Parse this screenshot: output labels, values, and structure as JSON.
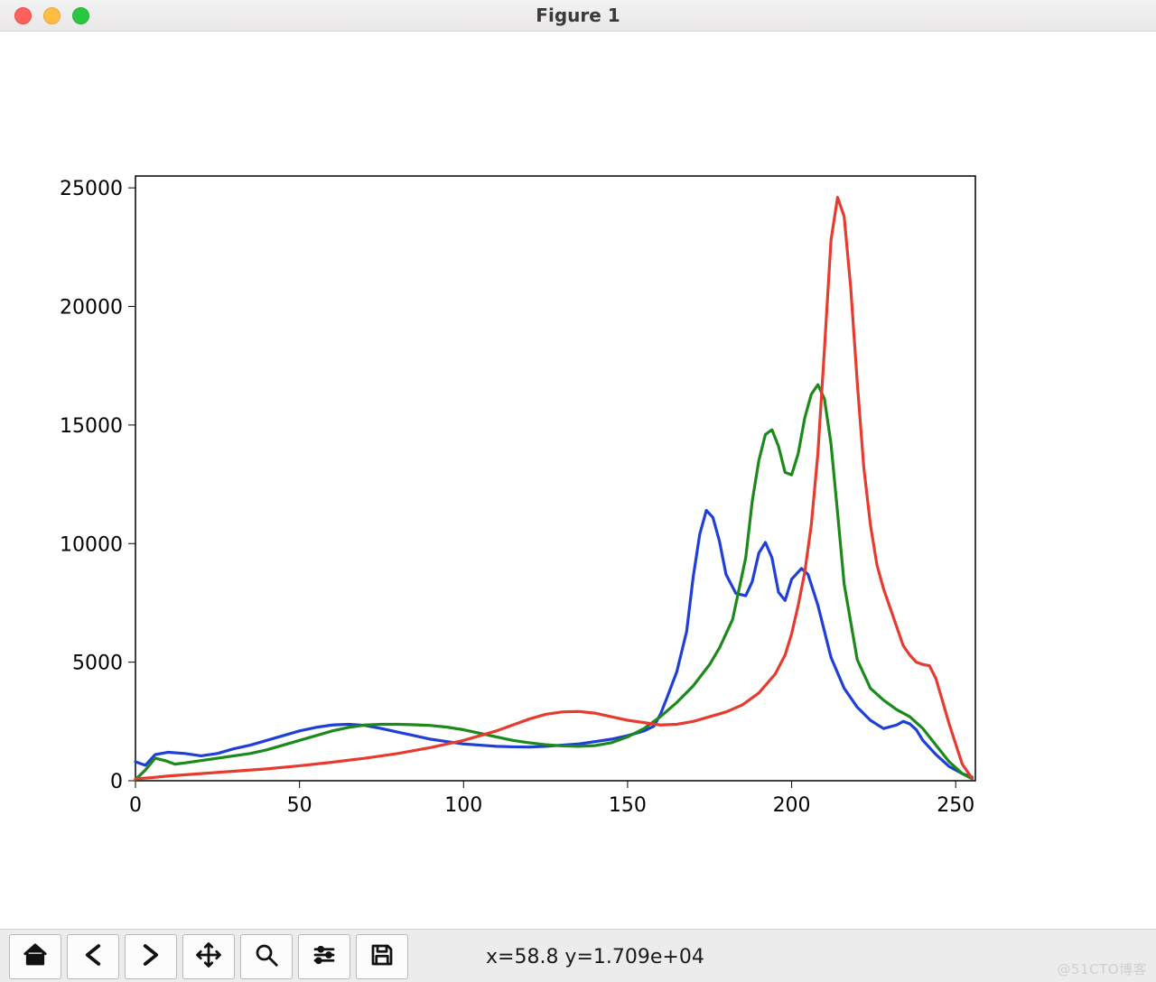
{
  "window_title": "Figure 1",
  "status": {
    "coord_text": "x=58.8 y=1.709e+04"
  },
  "watermark": "@51CTO博客",
  "toolbar": {
    "home": "Home",
    "back": "Back",
    "forward": "Forward",
    "pan": "Pan",
    "zoom": "Zoom",
    "config": "Configure",
    "save": "Save"
  },
  "chart_data": {
    "type": "line",
    "xlabel": "",
    "ylabel": "",
    "xlim": [
      0,
      256
    ],
    "ylim": [
      0,
      25500
    ],
    "xticks": [
      0,
      50,
      100,
      150,
      200,
      250
    ],
    "yticks": [
      0,
      5000,
      10000,
      15000,
      20000,
      25000
    ],
    "series": [
      {
        "name": "blue",
        "color": "#1f3fd7",
        "x": [
          0,
          3,
          6,
          10,
          15,
          20,
          25,
          30,
          35,
          40,
          45,
          50,
          55,
          60,
          65,
          70,
          75,
          80,
          85,
          90,
          95,
          100,
          105,
          110,
          115,
          120,
          125,
          130,
          135,
          140,
          145,
          150,
          155,
          158,
          160,
          162,
          165,
          168,
          170,
          172,
          174,
          176,
          178,
          180,
          183,
          186,
          188,
          190,
          192,
          194,
          196,
          198,
          200,
          203,
          205,
          208,
          212,
          216,
          220,
          224,
          228,
          232,
          234,
          236,
          238,
          240,
          244,
          248,
          252,
          255
        ],
        "y": [
          800,
          650,
          1100,
          1200,
          1150,
          1050,
          1150,
          1350,
          1500,
          1700,
          1900,
          2100,
          2250,
          2350,
          2380,
          2330,
          2200,
          2050,
          1900,
          1750,
          1650,
          1550,
          1500,
          1450,
          1430,
          1420,
          1450,
          1500,
          1550,
          1650,
          1750,
          1900,
          2100,
          2300,
          2800,
          3500,
          4600,
          6300,
          8600,
          10400,
          11400,
          11100,
          10100,
          8700,
          7900,
          7800,
          8400,
          9600,
          10050,
          9400,
          7950,
          7600,
          8500,
          8950,
          8700,
          7400,
          5200,
          3900,
          3100,
          2550,
          2200,
          2350,
          2500,
          2400,
          2150,
          1700,
          1100,
          600,
          300,
          150
        ]
      },
      {
        "name": "green",
        "color": "#1b8a1b",
        "x": [
          0,
          3,
          6,
          9,
          12,
          15,
          20,
          25,
          30,
          35,
          40,
          45,
          50,
          55,
          60,
          65,
          70,
          75,
          80,
          85,
          90,
          95,
          100,
          105,
          110,
          115,
          120,
          125,
          130,
          135,
          140,
          145,
          150,
          155,
          160,
          165,
          170,
          175,
          178,
          182,
          186,
          188,
          190,
          192,
          194,
          196,
          198,
          200,
          202,
          204,
          206,
          208,
          210,
          212,
          214,
          216,
          220,
          224,
          228,
          232,
          236,
          240,
          244,
          248,
          252,
          255
        ],
        "y": [
          50,
          450,
          950,
          850,
          700,
          750,
          850,
          950,
          1050,
          1150,
          1300,
          1500,
          1700,
          1900,
          2100,
          2250,
          2350,
          2380,
          2380,
          2360,
          2330,
          2260,
          2150,
          2000,
          1850,
          1700,
          1600,
          1520,
          1470,
          1450,
          1480,
          1600,
          1850,
          2200,
          2700,
          3300,
          4000,
          4900,
          5600,
          6800,
          9400,
          11800,
          13500,
          14600,
          14800,
          14100,
          13000,
          12900,
          13800,
          15300,
          16300,
          16700,
          16100,
          14200,
          11300,
          8300,
          5100,
          3900,
          3400,
          3000,
          2700,
          2200,
          1500,
          800,
          300,
          80
        ]
      },
      {
        "name": "red",
        "color": "#e63b2e",
        "x": [
          0,
          5,
          10,
          20,
          30,
          40,
          50,
          60,
          70,
          80,
          90,
          100,
          105,
          110,
          115,
          120,
          125,
          130,
          135,
          140,
          145,
          150,
          155,
          160,
          165,
          170,
          175,
          180,
          185,
          190,
          195,
          198,
          200,
          202,
          204,
          206,
          208,
          210,
          212,
          214,
          216,
          218,
          220,
          222,
          224,
          226,
          228,
          230,
          232,
          234,
          236,
          238,
          240,
          242,
          244,
          248,
          252,
          255
        ],
        "y": [
          80,
          130,
          200,
          300,
          400,
          500,
          630,
          780,
          950,
          1150,
          1400,
          1700,
          1900,
          2100,
          2350,
          2600,
          2800,
          2900,
          2920,
          2850,
          2700,
          2550,
          2450,
          2350,
          2380,
          2500,
          2700,
          2900,
          3200,
          3700,
          4500,
          5300,
          6200,
          7400,
          8800,
          10800,
          13800,
          18200,
          22800,
          24600,
          23800,
          20800,
          16800,
          13200,
          10800,
          9100,
          8100,
          7300,
          6500,
          5700,
          5300,
          5000,
          4900,
          4850,
          4300,
          2400,
          700,
          100
        ]
      }
    ]
  }
}
